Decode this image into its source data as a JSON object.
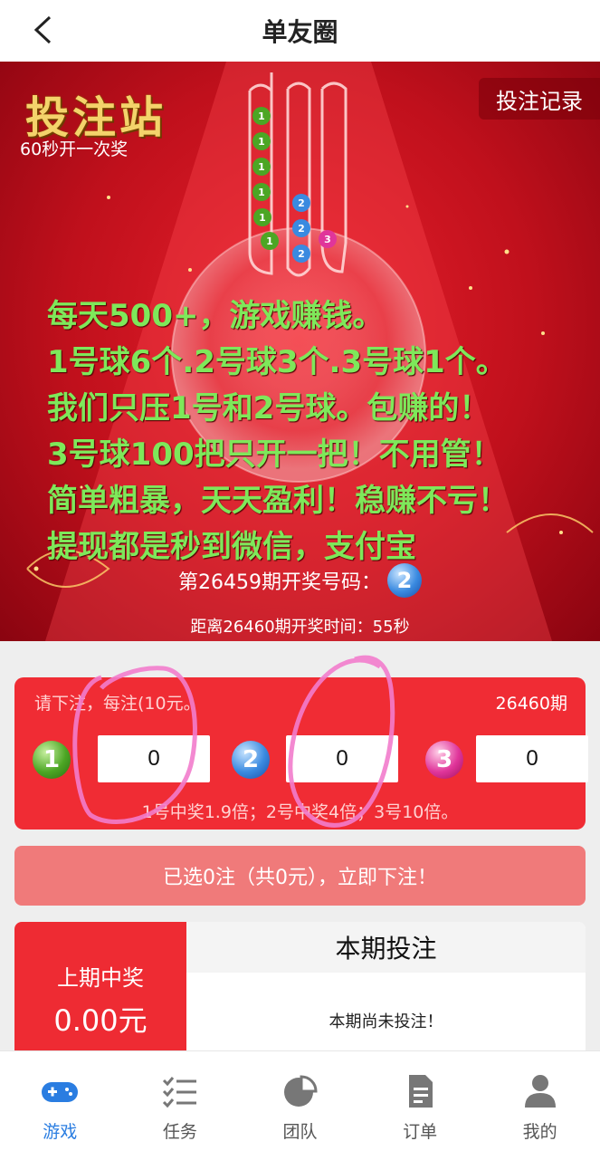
{
  "header": {
    "title": "单友圈"
  },
  "banner": {
    "logo": "投注站",
    "subtitle": "60秒开一次奖",
    "record_button": "投注记录",
    "promo_lines": [
      "每天500+，游戏赚钱。",
      "1号球6个.2号球3个.3号球1个。",
      "我们只压1号和2号球。包赚的！",
      "3号球100把只开一把！不用管！",
      "简单粗暴，天天盈利！稳赚不亏！",
      "提现都是秒到微信，支付宝"
    ],
    "draw_label": "第26459期开奖号码：",
    "draw_ball": "2",
    "countdown": "距离26460期开奖时间：55秒",
    "tube_balls": [
      "1",
      "1",
      "1",
      "1",
      "1",
      "1",
      "2",
      "2",
      "2",
      "3"
    ]
  },
  "bet": {
    "hint": "请下注，每注(10元。",
    "period": "26460期",
    "balls": [
      {
        "number": "1",
        "value": "0"
      },
      {
        "number": "2",
        "value": "0"
      },
      {
        "number": "3",
        "value": "0"
      }
    ],
    "odds": "1号中奖1.9倍；2号中奖4倍；3号10倍。",
    "submit_label": "已选0注（共0元），立即下注！"
  },
  "info": {
    "last_win_label": "上期中奖",
    "last_win_value": "0.00元",
    "current_title": "本期投注",
    "current_empty": "本期尚未投注！"
  },
  "tabbar": {
    "items": [
      {
        "label": "游戏",
        "icon": "gamepad-icon",
        "active": true
      },
      {
        "label": "任务",
        "icon": "task-list-icon",
        "active": false
      },
      {
        "label": "团队",
        "icon": "pie-chart-icon",
        "active": false
      },
      {
        "label": "订单",
        "icon": "document-icon",
        "active": false
      },
      {
        "label": "我的",
        "icon": "user-icon",
        "active": false
      }
    ]
  },
  "colors": {
    "brand_red": "#f02c34",
    "promo_green": "#7ee85a",
    "active_blue": "#2a7de1"
  }
}
